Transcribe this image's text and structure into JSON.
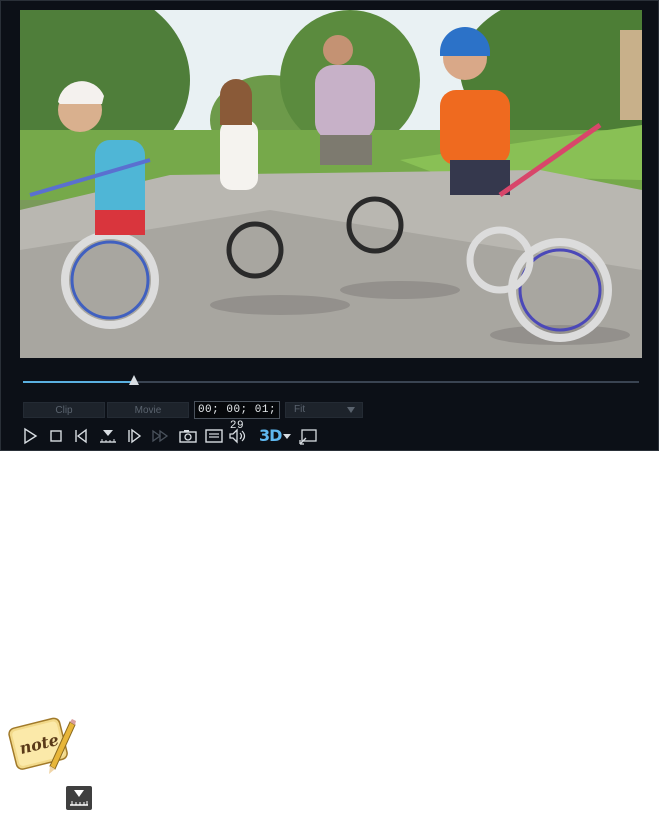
{
  "preview": {
    "tabs": [
      {
        "label": "Clip",
        "active": false
      },
      {
        "label": "Movie",
        "active": false
      }
    ],
    "timecode": "00; 00; 01; 29",
    "zoom": {
      "selected": "Fit"
    },
    "progress": 0.18
  },
  "controls": [
    {
      "name": "play-button",
      "icon": "play-icon"
    },
    {
      "name": "stop-button",
      "icon": "stop-icon"
    },
    {
      "name": "previous-frame-button",
      "icon": "previous-frame-icon"
    },
    {
      "name": "mark-in-button",
      "icon": "ruler-marker-icon"
    },
    {
      "name": "next-frame-button",
      "icon": "next-frame-icon"
    },
    {
      "name": "fast-forward-button",
      "icon": "fast-forward-icon",
      "disabled": true
    },
    {
      "name": "snapshot-button",
      "icon": "camera-icon"
    },
    {
      "name": "subtitles-button",
      "icon": "subtitles-icon"
    },
    {
      "name": "volume-button",
      "icon": "speaker-icon"
    },
    {
      "name": "3d-mode-button",
      "icon": "3d-icon"
    },
    {
      "name": "undock-button",
      "icon": "external-window-icon"
    }
  ],
  "threed_label": "3D",
  "colors": {
    "accent": "#5ab0e0",
    "panel": "#0c1017",
    "threed": "#5fb8f0"
  },
  "document": {
    "note_icon": "note-pencil-icon",
    "note_icon_text": "note",
    "marker_icon": "ruler-marker-icon"
  }
}
